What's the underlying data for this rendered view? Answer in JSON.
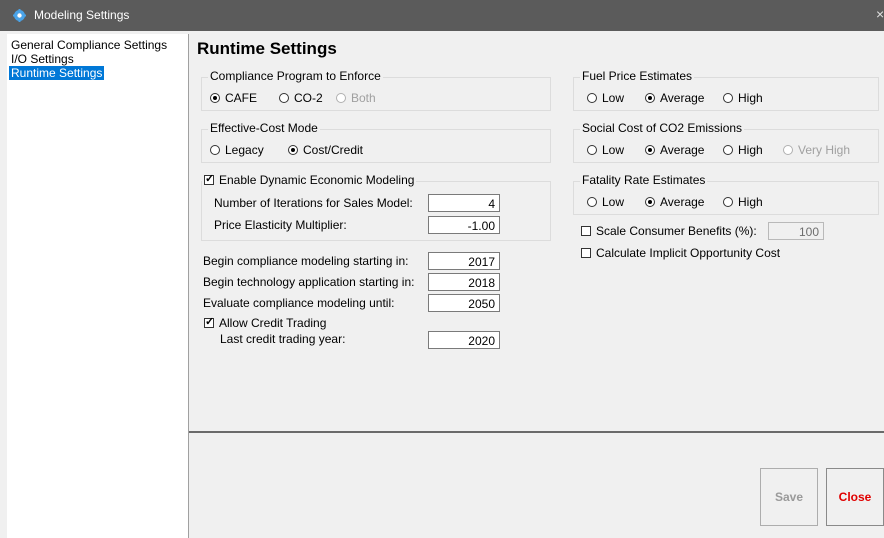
{
  "window": {
    "title": "Modeling Settings",
    "close_glyph": "×",
    "icon": "gear-icon"
  },
  "nav": {
    "items": [
      "General Compliance Settings",
      "I/O Settings",
      "Runtime Settings"
    ],
    "selected_index": 2
  },
  "heading": "Runtime Settings",
  "compliance_program": {
    "title": "Compliance Program to Enforce",
    "options": [
      "CAFE",
      "CO-2",
      "Both"
    ],
    "selected": "CAFE",
    "disabled": [
      "Both"
    ]
  },
  "effective_cost": {
    "title": "Effective-Cost Mode",
    "options": [
      "Legacy",
      "Cost/Credit"
    ],
    "selected": "Cost/Credit"
  },
  "dynamic_modeling": {
    "label": "Enable Dynamic Economic Modeling",
    "checked": true,
    "iterations_label": "Number of Iterations for Sales Model:",
    "iterations_value": "4",
    "elasticity_label": "Price Elasticity Multiplier:",
    "elasticity_value": "-1.00"
  },
  "years": {
    "begin_compliance_label": "Begin compliance modeling starting in:",
    "begin_compliance_value": "2017",
    "begin_technology_label": "Begin technology application starting in:",
    "begin_technology_value": "2018",
    "evaluate_until_label": "Evaluate compliance modeling until:",
    "evaluate_until_value": "2050"
  },
  "credit_trading": {
    "label": "Allow Credit Trading",
    "checked": true,
    "last_year_label": "Last credit trading year:",
    "last_year_value": "2020"
  },
  "fuel_price": {
    "title": "Fuel Price Estimates",
    "options": [
      "Low",
      "Average",
      "High"
    ],
    "selected": "Average"
  },
  "social_cost": {
    "title": "Social Cost of CO2 Emissions",
    "options": [
      "Low",
      "Average",
      "High",
      "Very High"
    ],
    "selected": "Average",
    "disabled": [
      "Very High"
    ]
  },
  "fatality_rate": {
    "title": "Fatality Rate Estimates",
    "options": [
      "Low",
      "Average",
      "High"
    ],
    "selected": "Average"
  },
  "consumer_benefits": {
    "label": "Scale Consumer Benefits (%):",
    "checked": false,
    "value": "100"
  },
  "opportunity_cost": {
    "label": "Calculate Implicit Opportunity Cost",
    "checked": false
  },
  "buttons": {
    "save": "Save",
    "close": "Close"
  },
  "colors": {
    "titlebar": "#5b5b5b",
    "selection": "#0078d7",
    "close_text": "#e00000"
  }
}
